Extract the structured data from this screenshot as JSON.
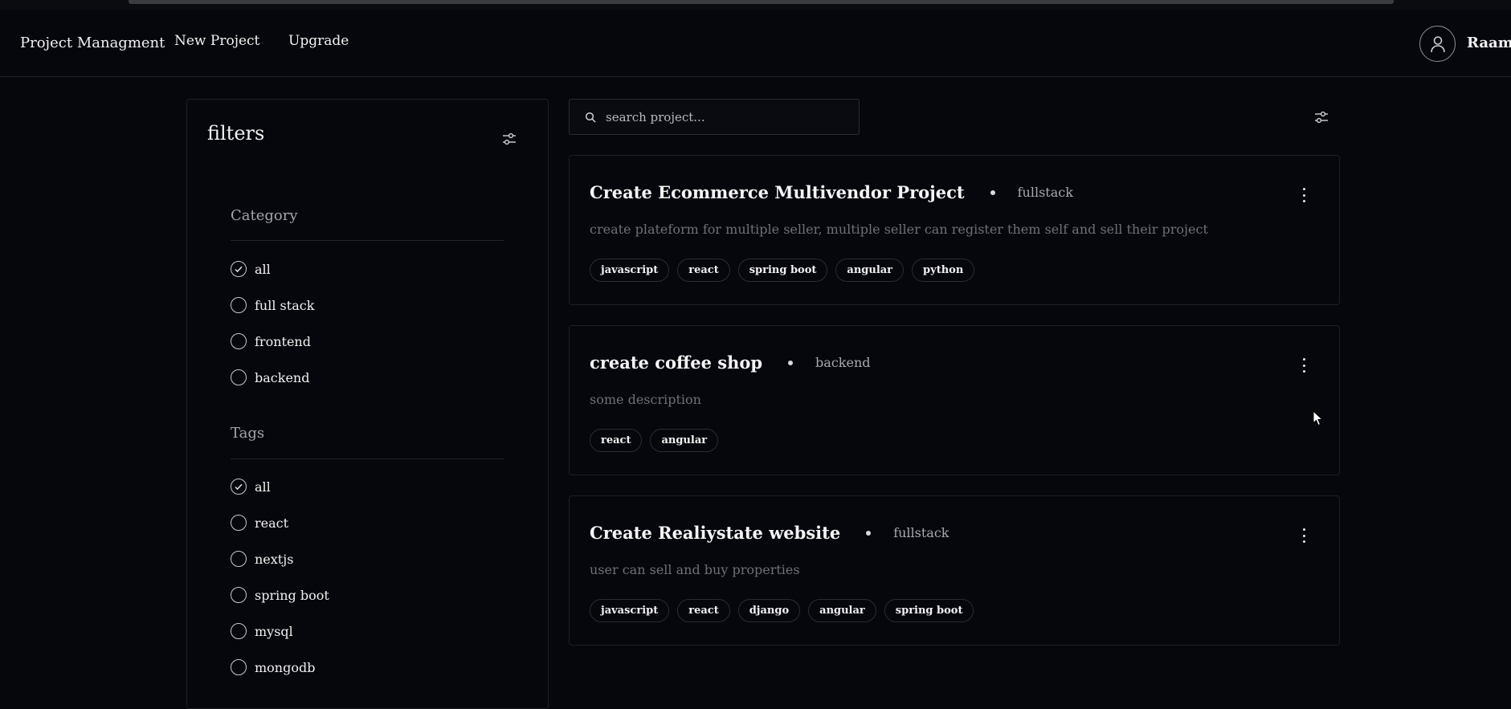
{
  "navbar": {
    "brand": "Project Managment",
    "new_project": "New Project",
    "upgrade": "Upgrade",
    "username": "Raam",
    "avatar_icon": "user-icon"
  },
  "sidebar": {
    "title": "filters",
    "filter_icon": "sliders-icon",
    "category": {
      "label": "Category",
      "options": [
        {
          "label": "all",
          "checked": true
        },
        {
          "label": "full stack",
          "checked": false
        },
        {
          "label": "frontend",
          "checked": false
        },
        {
          "label": "backend",
          "checked": false
        }
      ]
    },
    "tags": {
      "label": "Tags",
      "options": [
        {
          "label": "all",
          "checked": true
        },
        {
          "label": "react",
          "checked": false
        },
        {
          "label": "nextjs",
          "checked": false
        },
        {
          "label": "spring boot",
          "checked": false
        },
        {
          "label": "mysql",
          "checked": false
        },
        {
          "label": "mongodb",
          "checked": false
        }
      ]
    }
  },
  "search": {
    "placeholder": "search project...",
    "icon": "search-icon"
  },
  "projects": [
    {
      "title": "Create Ecommerce Multivendor Project",
      "category": "fullstack",
      "description": "create plateform for multiple seller, multiple seller can register them self and sell their project",
      "tags": [
        "javascript",
        "react",
        "spring boot",
        "angular",
        "python"
      ]
    },
    {
      "title": "create coffee shop",
      "category": "backend",
      "description": "some description",
      "tags": [
        "react",
        "angular"
      ]
    },
    {
      "title": "Create Realiystate website",
      "category": "fullstack",
      "description": "user can sell and buy properties",
      "tags": [
        "javascript",
        "react",
        "django",
        "angular",
        "spring boot"
      ]
    }
  ],
  "colors": {
    "background": "#06070c",
    "border": "#1d1f26",
    "text": "#f1f1f3",
    "muted": "#6f7076"
  }
}
